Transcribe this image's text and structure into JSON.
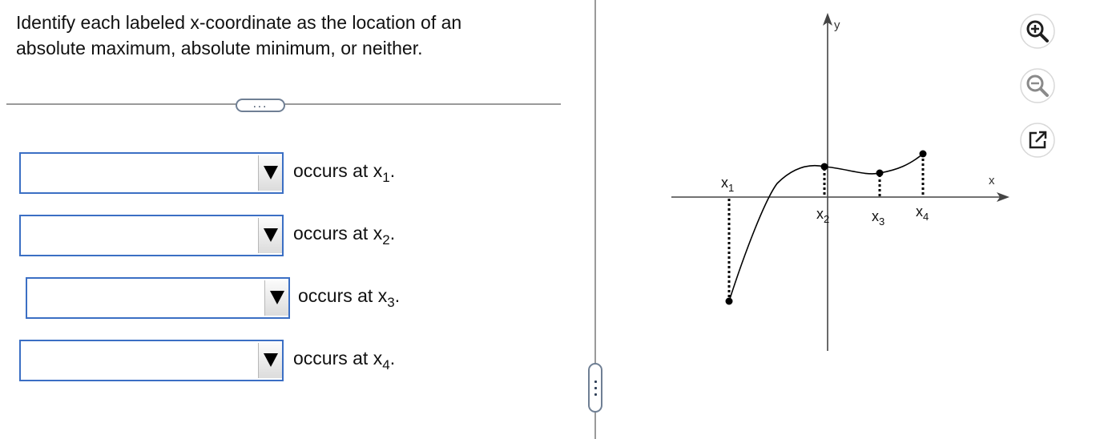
{
  "question": {
    "line1": "Identify each labeled x-coordinate as the location of an",
    "line2": "absolute maximum, absolute minimum, or neither."
  },
  "divider_handle": "...",
  "rows": [
    {
      "selected": "",
      "text": "occurs at x",
      "sub": "1",
      "period": "."
    },
    {
      "selected": "",
      "text": "occurs at x",
      "sub": "2",
      "period": "."
    },
    {
      "selected": "",
      "text": "occurs at x",
      "sub": "3",
      "period": "."
    },
    {
      "selected": "",
      "text": "occurs at x",
      "sub": "4",
      "period": "."
    }
  ],
  "graph": {
    "x_axis_label": "x",
    "y_axis_label": "y",
    "points": [
      {
        "label": "x",
        "sub": "1"
      },
      {
        "label": "x",
        "sub": "2"
      },
      {
        "label": "x",
        "sub": "3"
      },
      {
        "label": "x",
        "sub": "4"
      }
    ]
  },
  "tools": {
    "zoom_in_icon": "magnifier-plus-icon",
    "zoom_out_icon": "magnifier-minus-icon",
    "popout_icon": "open-in-new-window-icon"
  },
  "colors": {
    "select_border": "#3b6fc4",
    "tool_green": "#2e7d32",
    "divider": "#9a9a9a"
  }
}
